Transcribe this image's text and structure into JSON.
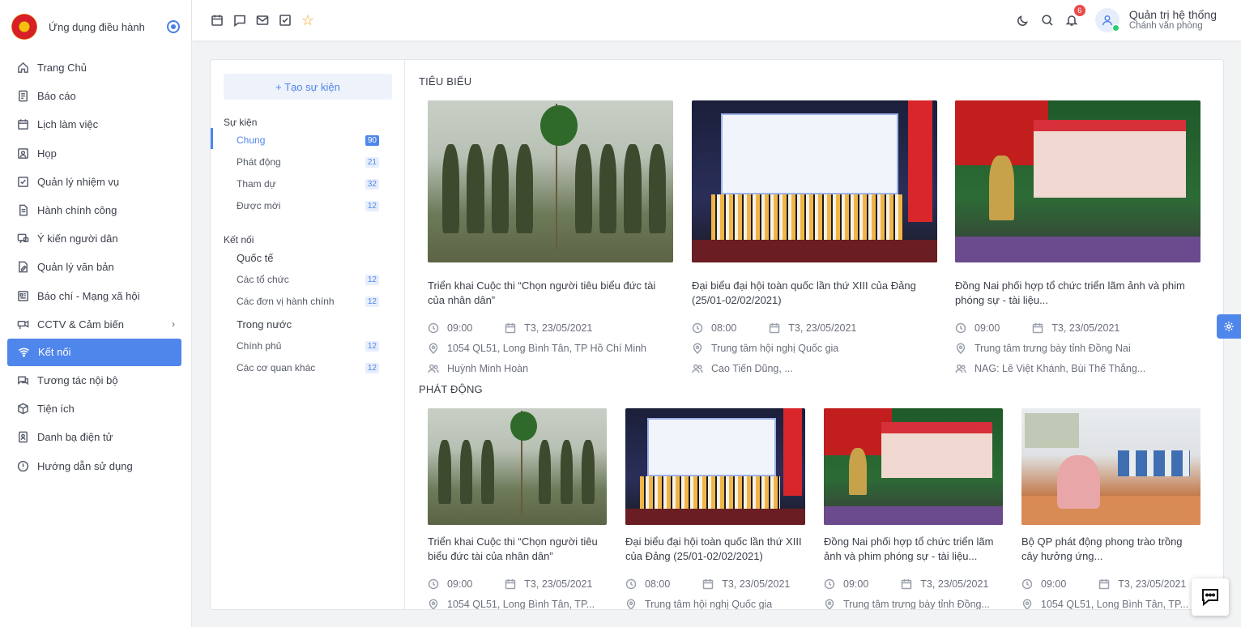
{
  "app": {
    "title": "Ứng dụng điều hành"
  },
  "sidebar": {
    "items": [
      {
        "label": "Trang Chủ",
        "icon": "home-icon"
      },
      {
        "label": "Báo cáo",
        "icon": "report-icon"
      },
      {
        "label": "Lịch làm việc",
        "icon": "calendar-icon"
      },
      {
        "label": "Họp",
        "icon": "meeting-icon"
      },
      {
        "label": "Quản lý nhiệm vụ",
        "icon": "task-icon"
      },
      {
        "label": "Hành chính công",
        "icon": "document-icon"
      },
      {
        "label": "Ý kiến người dân",
        "icon": "feedback-icon"
      },
      {
        "label": "Quản lý văn bản",
        "icon": "file-edit-icon"
      },
      {
        "label": "Báo chí - Mạng xã hội",
        "icon": "news-icon"
      },
      {
        "label": "CCTV & Cảm biến",
        "icon": "camera-icon"
      },
      {
        "label": "Kết nối",
        "icon": "wifi-icon"
      },
      {
        "label": "Tương tác nội bộ",
        "icon": "chat-icon"
      },
      {
        "label": "Tiện ích",
        "icon": "box-icon"
      },
      {
        "label": "Danh bạ điện tử",
        "icon": "phonebook-icon"
      },
      {
        "label": "Hướng dẫn sử dụng",
        "icon": "info-icon"
      }
    ],
    "active_index": 10
  },
  "topbar": {
    "notification_count": "6",
    "user_name": "Quản trị hệ thống",
    "user_role": "Chánh văn phòng"
  },
  "subnav": {
    "create_label": "+ Tạo sự kiện",
    "events_heading": "Sự kiện",
    "events": [
      {
        "label": "Chung",
        "count": "90"
      },
      {
        "label": "Phát động",
        "count": "21"
      },
      {
        "label": "Tham dự",
        "count": "32"
      },
      {
        "label": "Được mời",
        "count": "12"
      }
    ],
    "connect_heading": "Kết nối",
    "international_label": "Quốc tế",
    "international": [
      {
        "label": "Các tổ chức",
        "count": "12"
      },
      {
        "label": "Các đơn vị hành chính",
        "count": "12"
      }
    ],
    "domestic_label": "Trong nước",
    "domestic": [
      {
        "label": "Chính phủ",
        "count": "12"
      },
      {
        "label": "Các cơ quan khác",
        "count": "12"
      }
    ]
  },
  "featured": {
    "heading": "TIÊU BIỂU",
    "events": [
      {
        "title": "Triển khai Cuộc thi “Chọn người tiêu biểu đức tài của nhân dân”",
        "time": "09:00",
        "date": "T3, 23/05/2021",
        "location": "1054 QL51, Long Bình Tân, TP Hồ Chí Minh",
        "people": "Huỳnh Minh Hoàn"
      },
      {
        "title": "Đại biểu đại hội toàn quốc lần thứ XIII của Đảng (25/01-02/02/2021)",
        "time": "08:00",
        "date": "T3, 23/05/2021",
        "location": "Trung tâm hội nghị Quốc gia",
        "people": "Cao Tiến Dũng, ..."
      },
      {
        "title": "Đồng Nai phối hợp tổ chức triển lãm ảnh và phim phóng sự - tài liệu...",
        "time": "09:00",
        "date": "T3, 23/05/2021",
        "location": "Trung tâm trưng bày tỉnh Đồng Nai",
        "people": "NAG: Lê Việt Khánh, Bùi Thế Thắng..."
      }
    ]
  },
  "launch": {
    "heading": "PHÁT ĐỘNG",
    "events": [
      {
        "title": "Triển khai Cuộc thi “Chọn người tiêu biểu đức tài của nhân dân”",
        "time": "09:00",
        "date": "T3, 23/05/2021",
        "location": "1054 QL51, Long Bình Tân, TP..."
      },
      {
        "title": "Đại biểu đại hội toàn quốc lần thứ XIII của Đảng (25/01-02/02/2021)",
        "time": "08:00",
        "date": "T3, 23/05/2021",
        "location": "Trung tâm hội nghị Quốc gia"
      },
      {
        "title": "Đồng Nai phối hợp tổ chức triển lãm ảnh và phim phóng sự - tài liệu...",
        "time": "09:00",
        "date": "T3, 23/05/2021",
        "location": "Trung tâm trưng bày tỉnh Đồng..."
      },
      {
        "title": "Bộ QP phát động phong trào trồng cây hưởng ứng...",
        "time": "09:00",
        "date": "T3, 23/05/2021",
        "location": "1054 QL51, Long Bình Tân, TP..."
      }
    ]
  },
  "colors": {
    "accent": "#4f86ec",
    "badge": "#e94b4b",
    "star": "#f4a11c"
  }
}
